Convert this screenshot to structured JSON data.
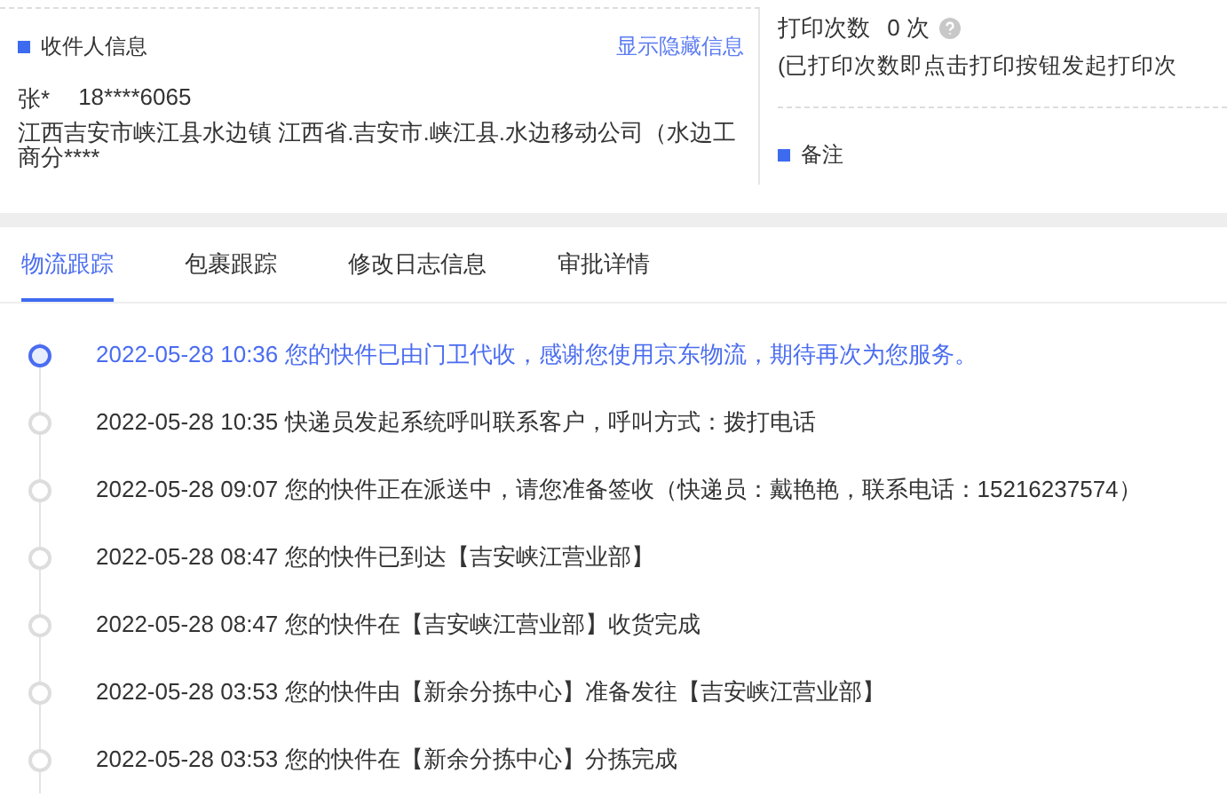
{
  "recipient": {
    "title": "收件人信息",
    "toggle_link": "显示隐藏信息",
    "name": "张*",
    "phone": "18****6065",
    "address": "江西吉安市峡江县水边镇 江西省.吉安市.峡江县.水边移动公司（水边工商分****"
  },
  "print": {
    "label": "打印次数",
    "count": "0 次",
    "note": "(已打印次数即点击打印按钮发起打印次"
  },
  "remarks": {
    "title": "备注"
  },
  "tabs": [
    {
      "label": "物流跟踪",
      "selected": true
    },
    {
      "label": "包裹跟踪",
      "selected": false
    },
    {
      "label": "修改日志信息",
      "selected": false
    },
    {
      "label": "审批详情",
      "selected": false
    }
  ],
  "timeline": [
    {
      "text": "2022-05-28 10:36 您的快件已由门卫代收，感谢您使用京东物流，期待再次为您服务。",
      "current": true
    },
    {
      "text": "2022-05-28 10:35 快递员发起系统呼叫联系客户，呼叫方式：拨打电话",
      "current": false
    },
    {
      "text": "2022-05-28 09:07 您的快件正在派送中，请您准备签收（快递员：戴艳艳，联系电话：15216237574）",
      "current": false
    },
    {
      "text": "2022-05-28 08:47 您的快件已到达【吉安峡江营业部】",
      "current": false
    },
    {
      "text": "2022-05-28 08:47 您的快件在【吉安峡江营业部】收货完成",
      "current": false
    },
    {
      "text": "2022-05-28 03:53 您的快件由【新余分拣中心】准备发往【吉安峡江营业部】",
      "current": false
    },
    {
      "text": "2022-05-28 03:53 您的快件在【新余分拣中心】分拣完成",
      "current": false
    }
  ]
}
